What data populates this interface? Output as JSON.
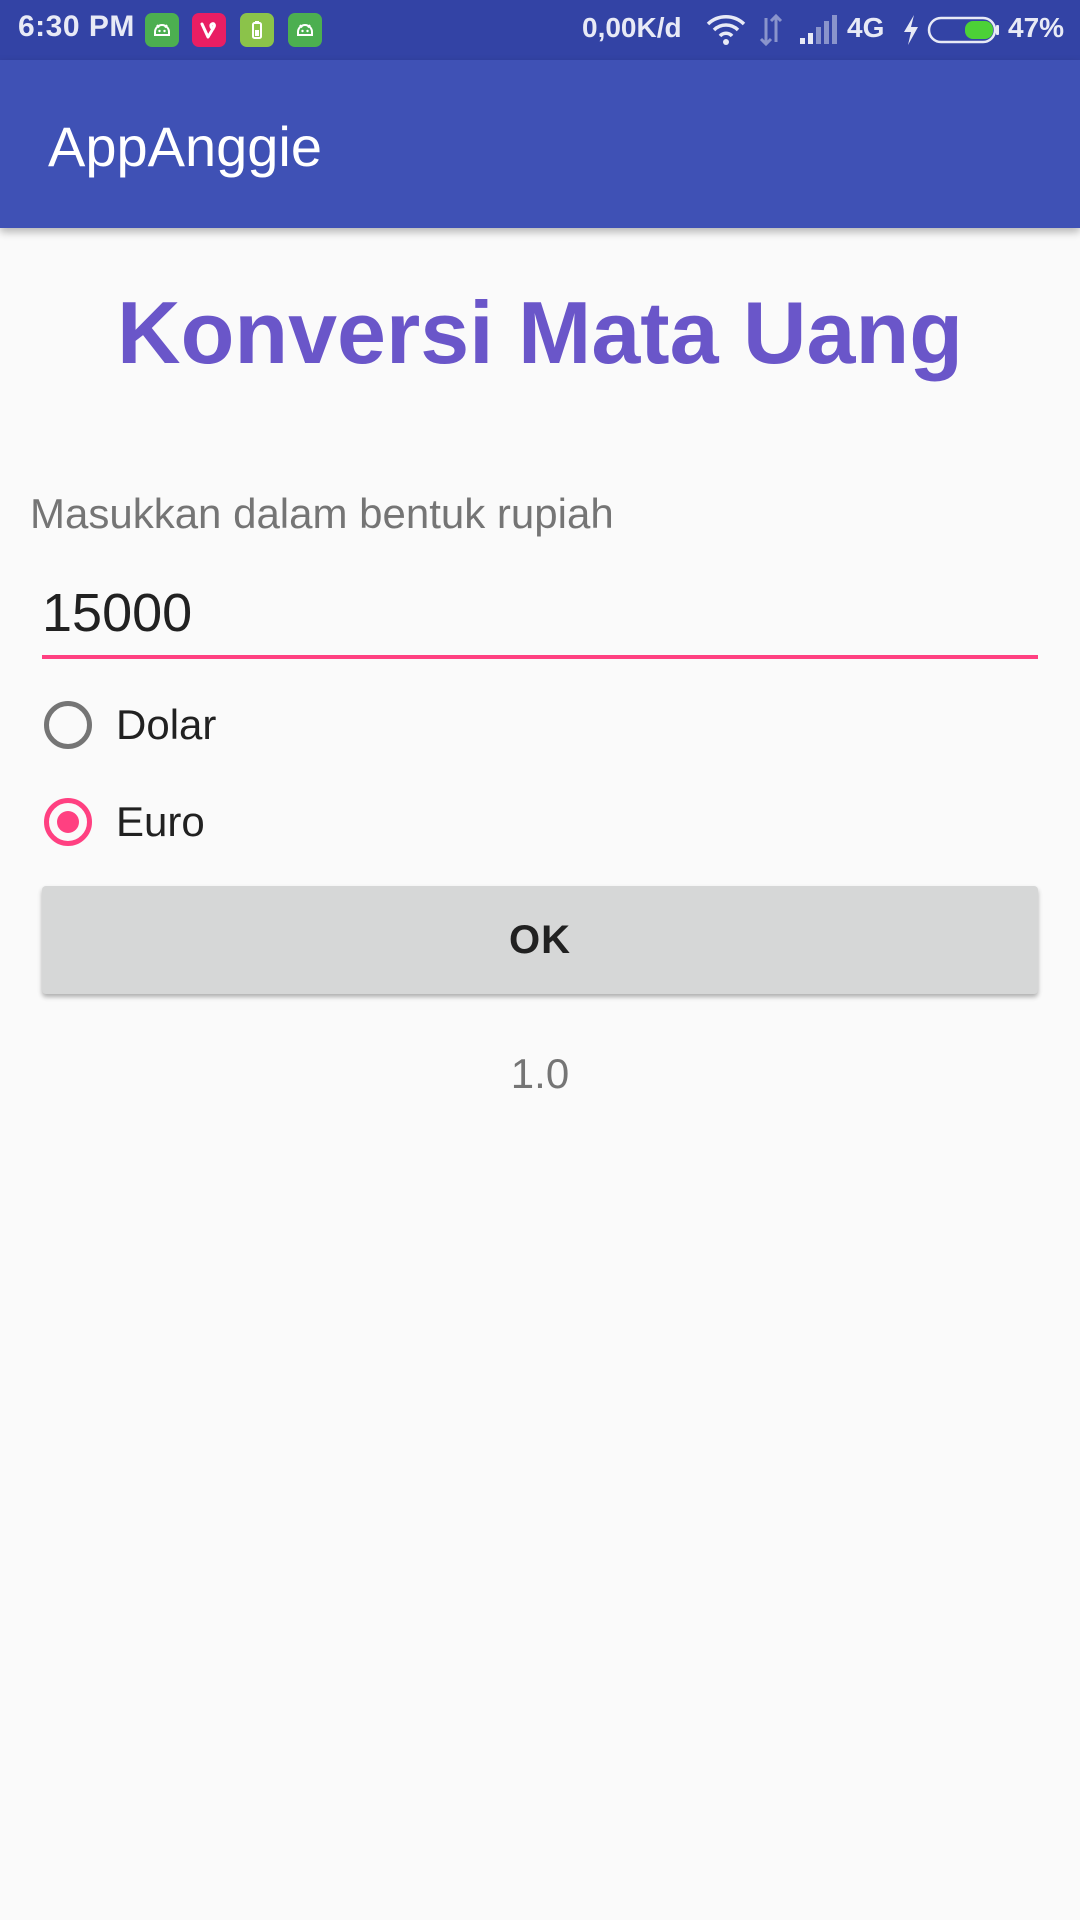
{
  "status_bar": {
    "time": "6:30 PM",
    "speed": "0,00K/d",
    "network": "4G",
    "battery": "47%",
    "notification_icons": [
      "android-icon",
      "vine-icon",
      "battery-saver-icon",
      "android-icon"
    ]
  },
  "app_bar": {
    "title": "AppAnggie"
  },
  "main": {
    "heading": "Konversi Mata Uang",
    "input_label": "Masukkan dalam bentuk rupiah",
    "input_value": "15000",
    "options": [
      {
        "label": "Dolar",
        "checked": false
      },
      {
        "label": "Euro",
        "checked": true
      }
    ],
    "button_label": "OK",
    "result": "1.0"
  },
  "colors": {
    "status_bar": "#3343A5",
    "primary": "#3F51B5",
    "accent": "#FF4081",
    "heading": "#6A56C9",
    "button": "#D6D7D7"
  }
}
